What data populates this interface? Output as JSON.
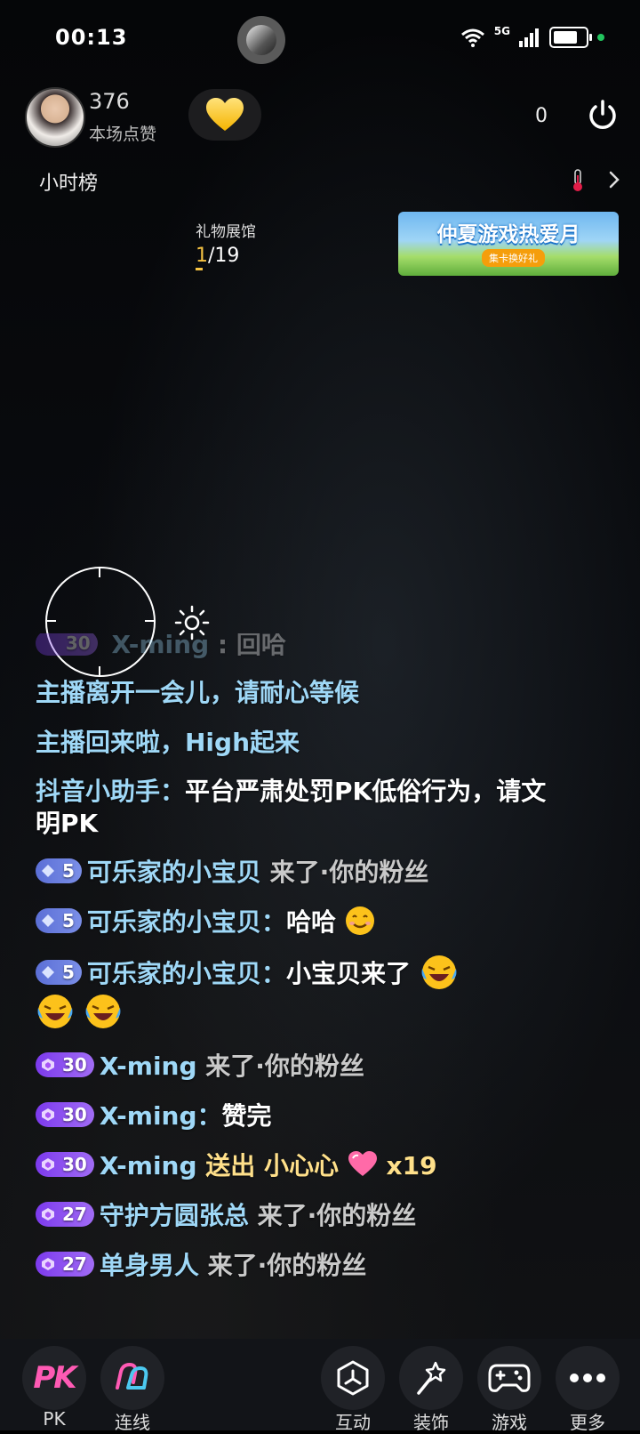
{
  "status_bar": {
    "time": "00:13",
    "network": "5G"
  },
  "top_bar": {
    "likes_count": "376",
    "likes_label": "本场点赞",
    "viewer_count": "0"
  },
  "rank": {
    "label": "小时榜"
  },
  "gift_hall": {
    "title": "礼物展馆",
    "current": "1",
    "total": "/19"
  },
  "banner": {
    "title": "仲夏游戏热爱月",
    "subtitle": "集卡换好礼"
  },
  "chat": {
    "faded": {
      "user": "X-ming",
      "text": "回哈"
    },
    "m1": "主播离开一会儿，请耐心等候",
    "m2": "主播回来啦，High起来",
    "m3": {
      "user": "抖音小助手：",
      "text": "平台严肃处罚PK低俗行为，请文明PK"
    },
    "m4": {
      "level": "5",
      "user": "可乐家的小宝贝",
      "text": " 来了·你的粉丝"
    },
    "m5": {
      "level": "5",
      "user": "可乐家的小宝贝：",
      "text": "哈哈"
    },
    "m6": {
      "level": "5",
      "user": "可乐家的小宝贝：",
      "text": "小宝贝来了"
    },
    "m7": {
      "level": "30",
      "user": "X-ming",
      "text": " 来了·你的粉丝"
    },
    "m8": {
      "level": "30",
      "user": "X-ming：",
      "text": "赞完"
    },
    "m9": {
      "level": "30",
      "user": "X-ming",
      "text": " 送出 小心心",
      "count": " x19"
    },
    "m10": {
      "level": "27",
      "user": "守护方圆张总",
      "text": " 来了·你的粉丝"
    },
    "m11": {
      "level": "27",
      "user": "单身男人",
      "text": " 来了·你的粉丝"
    }
  },
  "bottom_bar": {
    "pk_glyph": "PK",
    "pk": "PK",
    "connect": "连线",
    "interact": "互动",
    "decorate": "装饰",
    "games": "游戏",
    "more": "更多"
  },
  "colors": {
    "chat_name_blue": "#9fd8f7",
    "gift_gold": "#ffe08a",
    "badge_blue": "#5b6fd6",
    "badge_purple": "#7c3aed",
    "pk_pink": "#ff5ab4"
  }
}
